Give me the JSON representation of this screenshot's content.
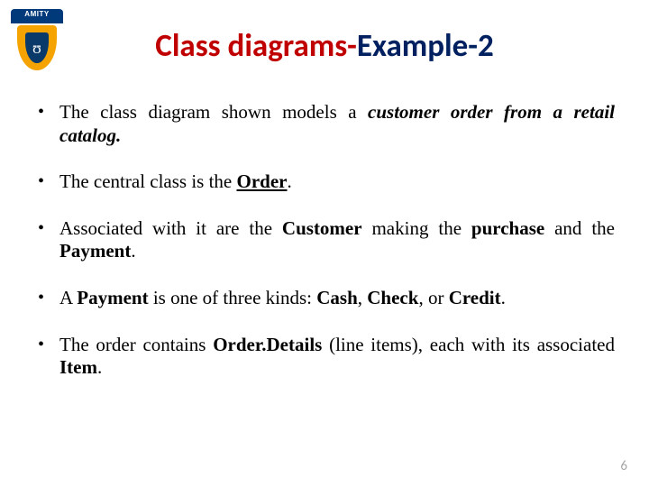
{
  "logo": {
    "text": "AMITY",
    "glyph": "ʊ"
  },
  "title": {
    "part1": "Class diagrams-",
    "part2": "Example-2"
  },
  "bullets": {
    "b1a": "The class diagram shown models a ",
    "b1b": "customer order from a retail catalog.",
    "b2a": "The central class is the ",
    "b2b": "Order",
    "b2c": ".",
    "b3a": "Associated with it are the ",
    "b3b": "Customer",
    "b3c": " making the ",
    "b3d": "purchase",
    "b3e": " and the ",
    "b3f": "Payment",
    "b3g": ".",
    "b4a": "A ",
    "b4b": "Payment",
    "b4c": " is one of three kinds: ",
    "b4d": "Cash",
    "b4e": ", ",
    "b4f": "Check",
    "b4g": ", or ",
    "b4h": "Credit",
    "b4i": ".",
    "b5a": "The order contains ",
    "b5b": "Order.Details",
    "b5c": " (line items), each with its associated ",
    "b5d": "Item",
    "b5e": "."
  },
  "pageNumber": "6"
}
